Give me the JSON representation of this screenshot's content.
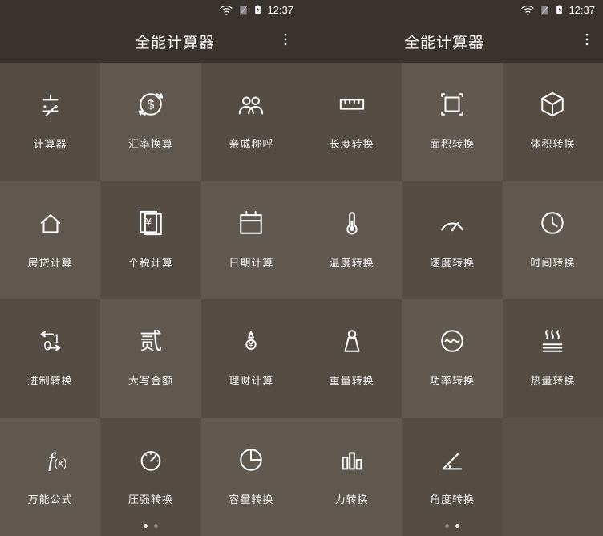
{
  "status": {
    "time": "12:37"
  },
  "left": {
    "title": "全能计算器",
    "activeDot": 0,
    "items": [
      {
        "id": "calculator",
        "label": "计算器"
      },
      {
        "id": "currency",
        "label": "汇率换算"
      },
      {
        "id": "relatives",
        "label": "亲戚称呼"
      },
      {
        "id": "mortgage",
        "label": "房贷计算"
      },
      {
        "id": "tax",
        "label": "个税计算"
      },
      {
        "id": "date",
        "label": "日期计算"
      },
      {
        "id": "radix",
        "label": "进制转换"
      },
      {
        "id": "cn-amount",
        "label": "大写金额"
      },
      {
        "id": "finance",
        "label": "理财计算"
      },
      {
        "id": "formula",
        "label": "万能公式"
      },
      {
        "id": "pressure",
        "label": "压强转换"
      },
      {
        "id": "volume-cap",
        "label": "容量转换"
      }
    ]
  },
  "right": {
    "title": "全能计算器",
    "activeDot": 1,
    "items": [
      {
        "id": "length",
        "label": "长度转换"
      },
      {
        "id": "area",
        "label": "面积转换"
      },
      {
        "id": "volume",
        "label": "体积转换"
      },
      {
        "id": "temperature",
        "label": "温度转换"
      },
      {
        "id": "speed",
        "label": "速度转换"
      },
      {
        "id": "time",
        "label": "时间转换"
      },
      {
        "id": "weight",
        "label": "重量转换"
      },
      {
        "id": "power",
        "label": "功率转换"
      },
      {
        "id": "heat",
        "label": "热量转换"
      },
      {
        "id": "force",
        "label": "力转换"
      },
      {
        "id": "angle",
        "label": "角度转换"
      }
    ]
  }
}
